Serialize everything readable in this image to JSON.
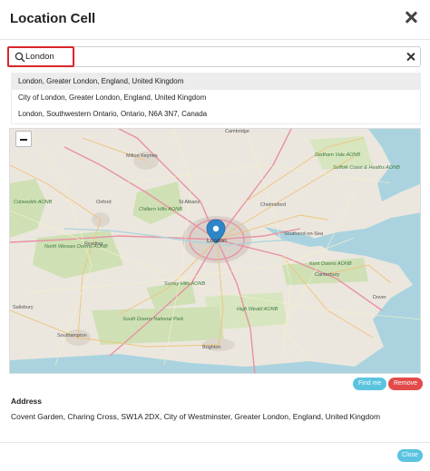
{
  "modal": {
    "title": "Location Cell",
    "close_icon": "close-icon"
  },
  "search": {
    "value": "London",
    "placeholder": "",
    "icon": "search-icon",
    "clear_icon": "close-icon"
  },
  "suggestions": [
    "London, Greater London, England, United Kingdom",
    "City of London, Greater London, England, United Kingdom",
    "London, Southwestern Ontario, Ontario, N6A 3N7, Canada"
  ],
  "map": {
    "zoom_out_label": "−",
    "marker_icon": "map-pin-icon",
    "labels": {
      "cambridge": "Cambridge",
      "milton_keynes": "Milton Keynes",
      "oxford": "Oxford",
      "st_albans": "St Albans",
      "chelmsford": "Chelmsford",
      "london": "London",
      "southend": "Southend-on-Sea",
      "reading": "Reading",
      "canterbury": "Canterbury",
      "dover": "Dover",
      "salisbury": "Salisbury",
      "southampton": "Southampton",
      "brighton": "Brighton",
      "cotswolds": "Cotswolds AONB",
      "chilterns": "Chiltern Hills AONB",
      "north_wessex": "North Wessex Downs AONB",
      "surrey_hills": "Surrey Hills AONB",
      "high_weald": "High Weald AONB",
      "south_downs": "South Downs National Park",
      "kent_downs": "Kent Downs AONB",
      "dedham": "Dedham Vale AONB",
      "suffolk": "Suffolk Coast & Heaths AONB"
    },
    "water_color": "#aad3df",
    "land_color": "#ebe7de",
    "park_color": "#cfe0b5",
    "urban_color": "#d8d2ca"
  },
  "buttons": {
    "find_me": "Find me",
    "remove": "Remove",
    "close": "Close"
  },
  "address": {
    "label": "Address",
    "value": "Covent Garden, Charing Cross, SW1A 2DX, City of Westminster, Greater London, England, United Kingdom"
  },
  "colors": {
    "accent": "#5ac4e0",
    "danger": "#e34b4b",
    "highlight": "#d9262b"
  }
}
